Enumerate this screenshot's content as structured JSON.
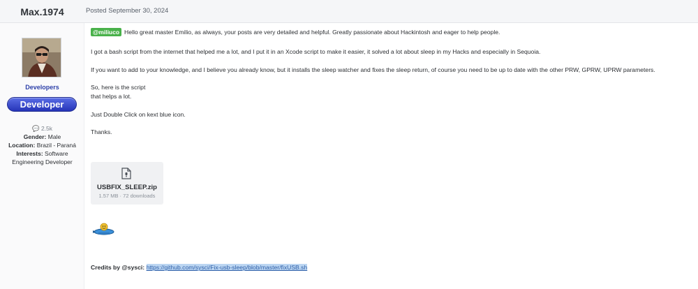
{
  "author": {
    "name": "Max.1974",
    "group": "Developers",
    "role_badge": "Developer",
    "post_count": "2.5k",
    "gender_label": "Gender:",
    "gender": "Male",
    "location_label": "Location:",
    "location": "Brazil - Paraná",
    "interests_label": "Interests:",
    "interests_line1": "Software",
    "interests_line2": "Engineering Developer"
  },
  "post": {
    "posted": "Posted September 30, 2024",
    "mention": "@miliuco",
    "p1": "Hello great master Emilio, as always, your posts are very detailed and helpful. Greatly passionate about Hackintosh and eager to help people.",
    "p2": "I got a bash script from the internet that helped me a lot, and I put it in an Xcode script to make it easier, it solved a lot about sleep in my Hacks and especially in Sequoia.",
    "p3": "If you want to add to your knowledge, and I believe you already know, but it installs the sleep watcher and fixes the sleep return, of course you need to be up to date with the other PRW, GPRW, UPRW parameters.",
    "p4a": "So, here is the script",
    "p4b": "that helps a lot.",
    "p5": "Just Double Click on kext blue icon.",
    "p6": "Thanks.",
    "attachment": {
      "filename": "USBFIX_SLEEP.zip",
      "meta": "1.57 MB · 72 downloads"
    },
    "credits_label": "Credits by @sysci:",
    "credits_link": "https://github.com/sysci/Fix-usb-sleep/blob/master/fixUSB.sh"
  },
  "colors": {
    "mention_bg": "#49b14a",
    "badge": "#3447cc",
    "link_highlight": "#bcd6f2"
  }
}
